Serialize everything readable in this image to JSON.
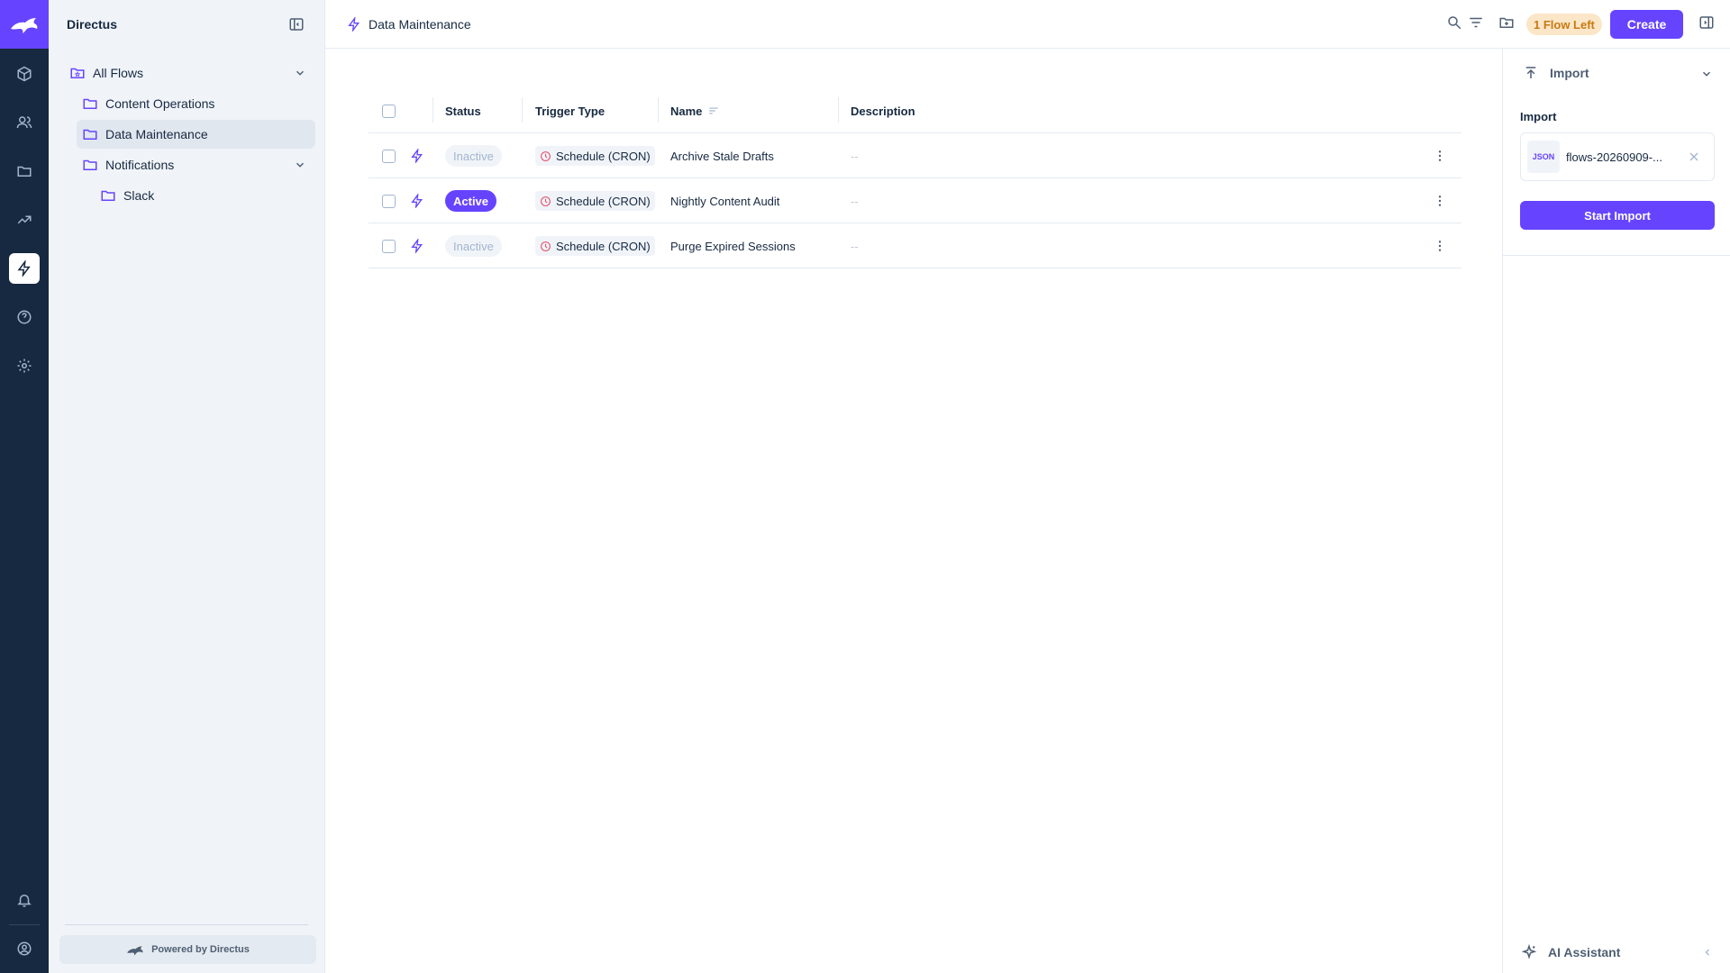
{
  "app": {
    "title": "Directus"
  },
  "header": {
    "title": "Data Maintenance",
    "flows_left_badge": "1 Flow Left",
    "create_label": "Create"
  },
  "nav": {
    "items": [
      {
        "label": "All Flows",
        "icon": "folder-special-icon",
        "expanded": true
      },
      {
        "label": "Content Operations",
        "icon": "folder-icon"
      },
      {
        "label": "Data Maintenance",
        "icon": "folder-icon",
        "selected": true
      },
      {
        "label": "Notifications",
        "icon": "folder-icon",
        "expanded": true
      },
      {
        "label": "Slack",
        "icon": "folder-icon"
      }
    ],
    "powered_by": "Powered by Directus"
  },
  "table": {
    "columns": {
      "status": "Status",
      "trigger_type": "Trigger Type",
      "name": "Name",
      "description": "Description"
    },
    "rows": [
      {
        "status": "Inactive",
        "trigger": "Schedule (CRON)",
        "name": "Archive Stale Drafts",
        "description": "--"
      },
      {
        "status": "Active",
        "trigger": "Schedule (CRON)",
        "name": "Nightly Content Audit",
        "description": "--"
      },
      {
        "status": "Inactive",
        "trigger": "Schedule (CRON)",
        "name": "Purge Expired Sessions",
        "description": "--"
      }
    ]
  },
  "sidebar": {
    "import_section_title": "Import",
    "import_label": "Import",
    "file_type": "JSON",
    "file_name": "flows-20260909-...",
    "start_import_label": "Start Import",
    "ai_assistant_label": "AI Assistant"
  },
  "colors": {
    "accent": "#6644ff",
    "module_bar": "#172940",
    "badge_bg": "#fbe6c8",
    "badge_text": "#c97a12"
  }
}
